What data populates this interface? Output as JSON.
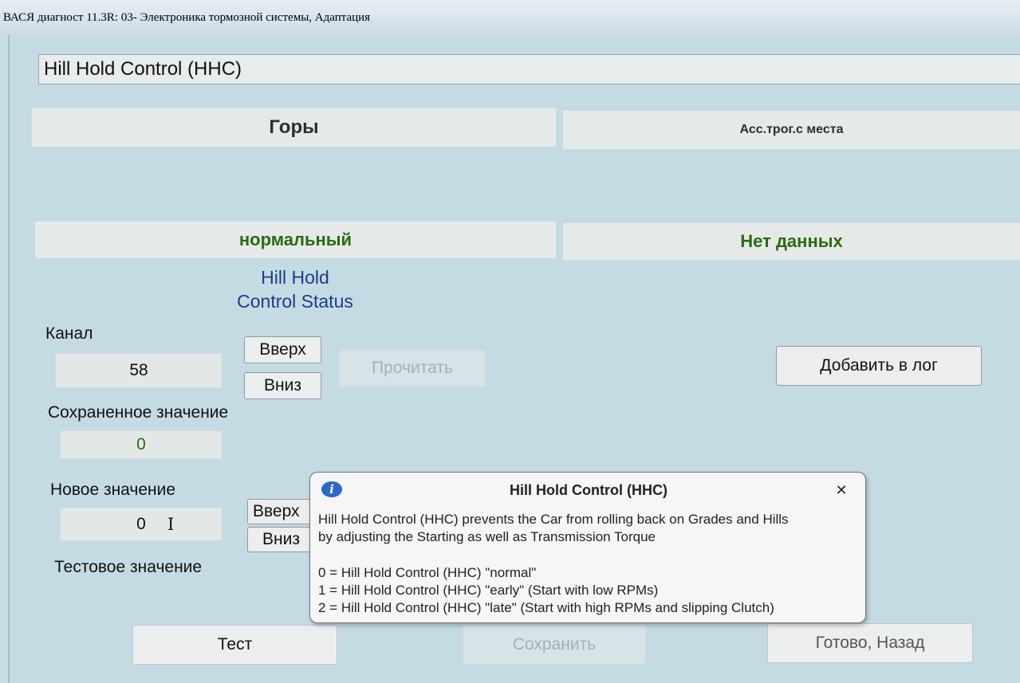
{
  "window": {
    "title": "ВАСЯ диагност 11.3R: 03- Электроника тормозной системы, Адаптация"
  },
  "adaptation": {
    "selected": "Hill Hold Control (HHC)"
  },
  "panels": {
    "top_left": "Горы",
    "top_right": "Асс.трог.с места",
    "mid_left": "нормальный",
    "mid_right": "Нет данных"
  },
  "status_caption": {
    "line1": "Hill Hold",
    "line2": "Control Status"
  },
  "channel": {
    "label": "Канал",
    "value": "58",
    "up": "Вверх",
    "down": "Вниз",
    "read": "Прочитать"
  },
  "add_log": "Добавить в лог",
  "stored": {
    "label": "Сохраненное значение",
    "value": "0"
  },
  "new_value": {
    "label": "Новое значение",
    "value": "0",
    "up": "Вверх",
    "down": "Вниз"
  },
  "test_value": {
    "label": "Тестовое значение"
  },
  "footer": {
    "test": "Тест",
    "save": "Сохранить",
    "done": "Готово, Назад"
  },
  "dialog": {
    "title": "Hill Hold Control (HHC)",
    "line1": "Hill Hold Control (HHC) prevents the Car from rolling back on Grades and Hills",
    "line2": "by adjusting the Starting as well as Transmission Torque",
    "opt0": "0 = Hill Hold Control (HHC) \"normal\"",
    "opt1": "1 = Hill Hold Control (HHC) \"early\" (Start with low RPMs)",
    "opt2": "2 = Hill Hold Control (HHC) \"late\" (Start with high RPMs and slipping Clutch)"
  },
  "icons": {
    "info": "info-icon",
    "close": "close-icon",
    "cursor": "text-cursor-icon"
  },
  "colors": {
    "background": "#c5dbe4",
    "green_text": "#2c6a12",
    "blue_text": "#1d3c8a",
    "info": "#2a68c9"
  }
}
